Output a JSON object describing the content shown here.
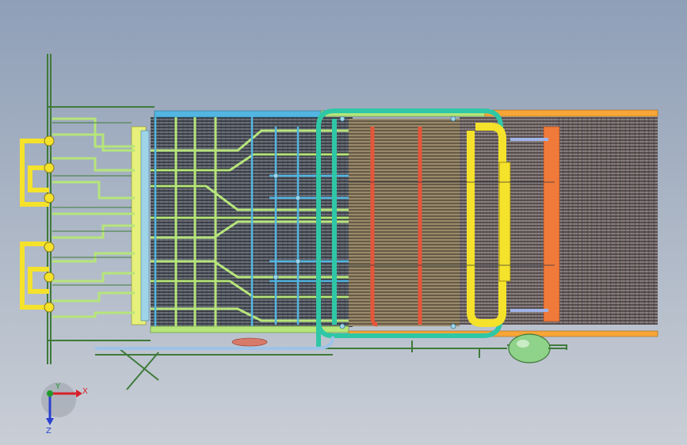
{
  "triad": {
    "x_label": "X",
    "y_label": "Y",
    "z_label": "Z",
    "x_color": "#d8202a",
    "y_color": "#1f9a2a",
    "z_color": "#2a3fd0"
  },
  "colors": {
    "frame_green": "#3f7a3a",
    "header_yellow": "#f5e22a",
    "pipe_teal": "#2fc7a6",
    "pipe_blue": "#53b6e2",
    "pipe_lime": "#b6e57a",
    "header_orange": "#f7a637",
    "header_red": "#e5553a",
    "drum_green": "#8fd28a",
    "tube_dark": "#2a2e3a"
  }
}
